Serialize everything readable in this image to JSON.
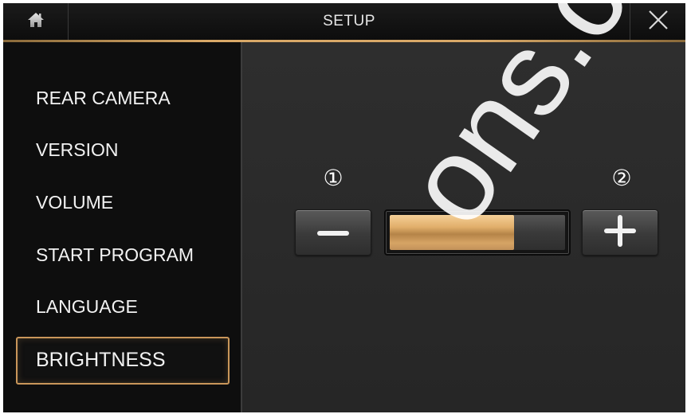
{
  "header": {
    "title": "SETUP",
    "home_icon": "home-icon",
    "close_icon": "close-icon"
  },
  "sidebar": {
    "items": [
      {
        "label": "REAR CAMERA",
        "selected": false
      },
      {
        "label": "VERSION",
        "selected": false
      },
      {
        "label": "VOLUME",
        "selected": false
      },
      {
        "label": "START PROGRAM",
        "selected": false
      },
      {
        "label": "LANGUAGE",
        "selected": false
      },
      {
        "label": "BRIGHTNESS",
        "selected": true
      }
    ]
  },
  "main": {
    "callouts": [
      "①",
      "②"
    ],
    "decrease_icon": "minus-icon",
    "increase_icon": "plus-icon",
    "brightness_level": 0.71
  },
  "watermark": "ons.c",
  "colors": {
    "accent": "#d9a968",
    "fill": "#e1ae6a",
    "background": "#2b2b2b",
    "sidebar": "#0e0e0e"
  }
}
